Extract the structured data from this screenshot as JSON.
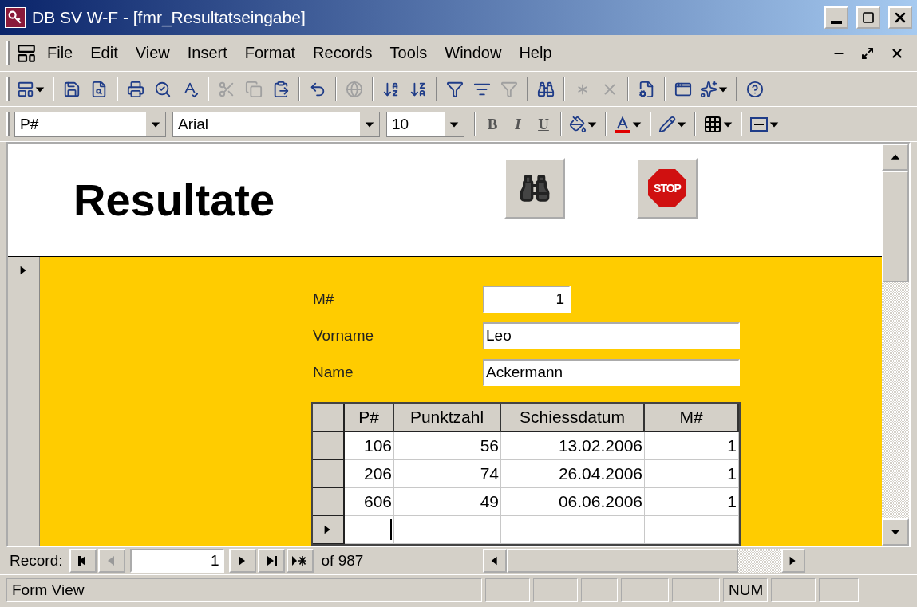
{
  "window": {
    "title": "DB SV W-F - [fmr_Resultatseingabe]"
  },
  "menu": [
    "File",
    "Edit",
    "View",
    "Insert",
    "Format",
    "Records",
    "Tools",
    "Window",
    "Help"
  ],
  "toolbar": [
    {
      "kind": "design",
      "disabled": false,
      "dropdown": true
    },
    {
      "kind": "separator"
    },
    {
      "kind": "save",
      "disabled": false,
      "dropdown": false
    },
    {
      "kind": "search-file",
      "disabled": false,
      "dropdown": false
    },
    {
      "kind": "separator"
    },
    {
      "kind": "print",
      "disabled": false,
      "dropdown": false
    },
    {
      "kind": "preview",
      "disabled": false,
      "dropdown": false
    },
    {
      "kind": "spell",
      "disabled": false,
      "dropdown": false
    },
    {
      "kind": "separator"
    },
    {
      "kind": "cut",
      "disabled": true,
      "dropdown": false
    },
    {
      "kind": "copy",
      "disabled": true,
      "dropdown": false
    },
    {
      "kind": "paste",
      "disabled": false,
      "dropdown": false
    },
    {
      "kind": "separator"
    },
    {
      "kind": "undo",
      "disabled": false,
      "dropdown": false
    },
    {
      "kind": "separator"
    },
    {
      "kind": "globe",
      "disabled": true,
      "dropdown": false
    },
    {
      "kind": "separator"
    },
    {
      "kind": "sort-asc",
      "disabled": false,
      "dropdown": false
    },
    {
      "kind": "sort-desc",
      "disabled": false,
      "dropdown": false
    },
    {
      "kind": "separator"
    },
    {
      "kind": "filter-selection",
      "disabled": false,
      "dropdown": false
    },
    {
      "kind": "filter-form",
      "disabled": false,
      "dropdown": false
    },
    {
      "kind": "filter",
      "disabled": true,
      "dropdown": false
    },
    {
      "kind": "separator"
    },
    {
      "kind": "find",
      "disabled": false,
      "dropdown": false
    },
    {
      "kind": "separator"
    },
    {
      "kind": "new-record",
      "disabled": true,
      "dropdown": false
    },
    {
      "kind": "delete-record",
      "disabled": true,
      "dropdown": false
    },
    {
      "kind": "separator"
    },
    {
      "kind": "properties",
      "disabled": false,
      "dropdown": false
    },
    {
      "kind": "separator"
    },
    {
      "kind": "database-window",
      "disabled": false,
      "dropdown": false
    },
    {
      "kind": "new-object",
      "disabled": false,
      "dropdown": true
    },
    {
      "kind": "separator"
    },
    {
      "kind": "help",
      "disabled": false,
      "dropdown": false
    }
  ],
  "format_toolbar": {
    "object": "P#",
    "font": "Arial",
    "size": "10",
    "styles": [
      "B",
      "I",
      "U"
    ]
  },
  "header": {
    "title": "Resultate",
    "stop_label": "STOP"
  },
  "fields": [
    {
      "label": "M#",
      "value": "1",
      "kind": "number"
    },
    {
      "label": "Vorname",
      "value": "Leo",
      "kind": "text"
    },
    {
      "label": "Name",
      "value": "Ackermann",
      "kind": "text"
    }
  ],
  "subform": {
    "columns": [
      "P#",
      "Punktzahl",
      "Schiessdatum",
      "M#"
    ],
    "rows": [
      {
        "cells": [
          "106",
          "56",
          "13.02.2006",
          "1"
        ],
        "current": false
      },
      {
        "cells": [
          "206",
          "74",
          "26.04.2006",
          "1"
        ],
        "current": false
      },
      {
        "cells": [
          "606",
          "49",
          "06.06.2006",
          "1"
        ],
        "current": false
      },
      {
        "cells": [],
        "current": true
      }
    ]
  },
  "navigation": {
    "label": "Record:",
    "record": "1",
    "total": "of 987"
  },
  "status_bar": {
    "text": "Form View",
    "indicator": "NUM"
  }
}
